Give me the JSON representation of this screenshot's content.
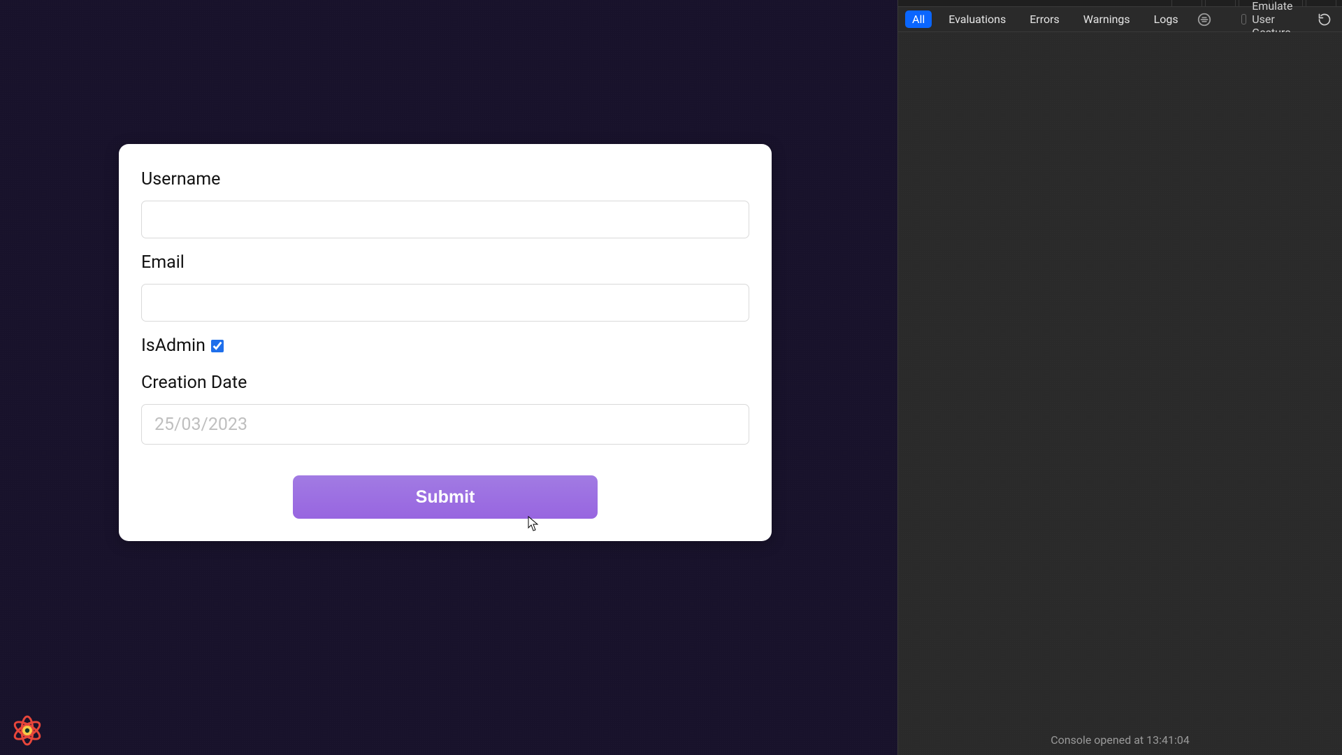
{
  "form": {
    "username_label": "Username",
    "username_value": "",
    "email_label": "Email",
    "email_value": "",
    "isadmin_label": "IsAdmin",
    "isadmin_checked": true,
    "creationdate_label": "Creation Date",
    "creationdate_value": "25/03/2023",
    "submit_label": "Submit"
  },
  "devtools": {
    "filters": {
      "all": "All",
      "evaluations": "Evaluations",
      "errors": "Errors",
      "warnings": "Warnings",
      "logs": "Logs"
    },
    "active_filter": "all",
    "emulate_label": "Emulate User Gesture",
    "emulate_checked": false,
    "console_status": "Console opened at 13:41:04"
  }
}
